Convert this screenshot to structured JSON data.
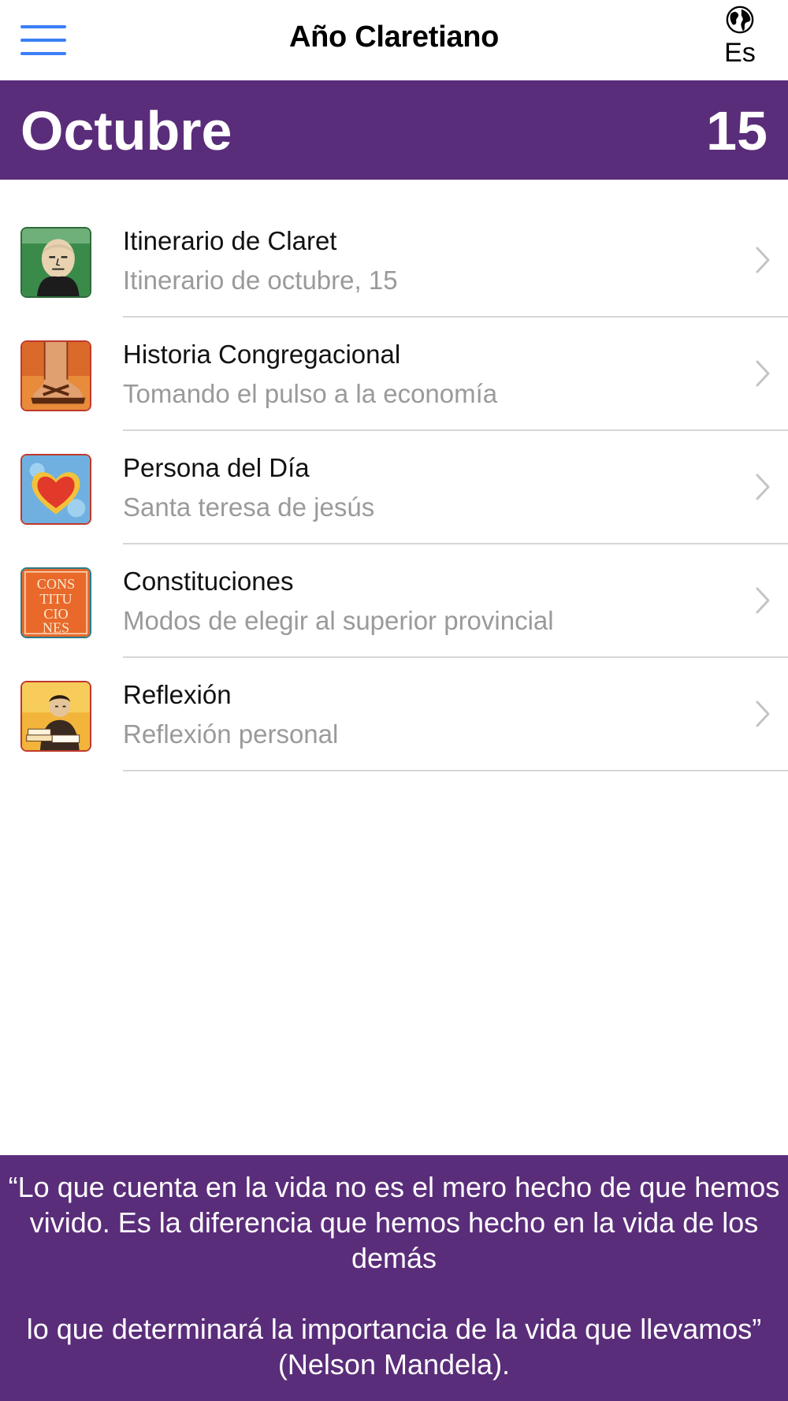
{
  "navbar": {
    "title": "Año Claretiano",
    "menu_icon": "hamburger-menu-icon",
    "language_icon": "globe-icon",
    "language_label": "Es"
  },
  "date_header": {
    "month": "Octubre",
    "day": "15"
  },
  "items": [
    {
      "title": "Itinerario de Claret",
      "subtitle": "Itinerario de octubre, 15",
      "icon": "claret-portrait-icon"
    },
    {
      "title": "Historia Congregacional",
      "subtitle": "Tomando el pulso a la economía",
      "icon": "sandal-foot-icon"
    },
    {
      "title": "Persona del Día",
      "subtitle": "Santa teresa de jesús",
      "icon": "heart-icon"
    },
    {
      "title": "Constituciones",
      "subtitle": "Modos de elegir al superior provincial",
      "icon": "constituciones-icon"
    },
    {
      "title": "Reflexión",
      "subtitle": "Reflexión personal",
      "icon": "reading-person-icon"
    }
  ],
  "constituciones_icon_text": "CONS TITU CIO NES",
  "quote": {
    "paragraph1": "“Lo que cuenta en la vida no es el mero hecho de que hemos vivido. Es la diferencia que hemos hecho en la vida de los demás",
    "paragraph2": "lo que determinará la importancia de la vida que llevamos” (Nelson Mandela)."
  },
  "colors": {
    "purple": "#5a2d7a",
    "accent_blue": "#3a7ff6",
    "subtitle_gray": "#9a9a9a"
  }
}
